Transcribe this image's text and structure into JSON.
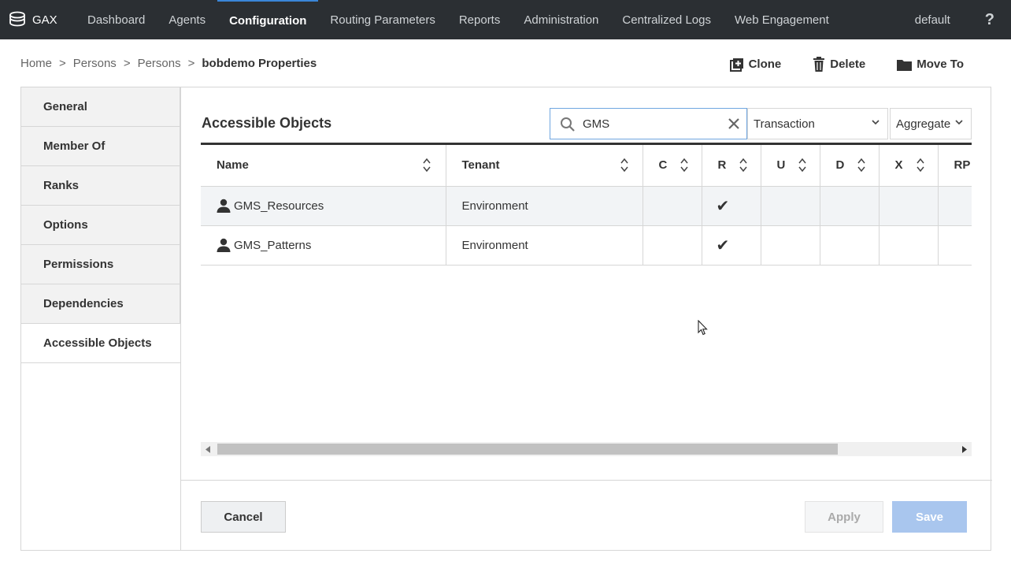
{
  "topnav": {
    "logo": "GAX",
    "items": [
      {
        "label": "Dashboard",
        "active": false
      },
      {
        "label": "Agents",
        "active": false
      },
      {
        "label": "Configuration",
        "active": true
      },
      {
        "label": "Routing Parameters",
        "active": false
      },
      {
        "label": "Reports",
        "active": false
      },
      {
        "label": "Administration",
        "active": false
      },
      {
        "label": "Centralized Logs",
        "active": false
      },
      {
        "label": "Web Engagement",
        "active": false
      }
    ],
    "user": "default",
    "help": "?"
  },
  "breadcrumb": {
    "items": [
      "Home",
      "Persons",
      "Persons"
    ],
    "separator": ">",
    "current": "bobdemo Properties"
  },
  "toolbar": {
    "clone_label": "Clone",
    "delete_label": "Delete",
    "move_label": "Move To"
  },
  "sidebar": {
    "items": [
      {
        "label": "General",
        "active": false
      },
      {
        "label": "Member Of",
        "active": false
      },
      {
        "label": "Ranks",
        "active": false
      },
      {
        "label": "Options",
        "active": false
      },
      {
        "label": "Permissions",
        "active": false
      },
      {
        "label": "Dependencies",
        "active": false
      },
      {
        "label": "Accessible Objects",
        "active": true
      }
    ]
  },
  "main": {
    "title": "Accessible Objects",
    "search": {
      "value": "GMS",
      "placeholder": ""
    },
    "type_select": "Transaction",
    "aggregate_select": "Aggregate",
    "table": {
      "columns": [
        "Name",
        "Tenant",
        "C",
        "R",
        "U",
        "D",
        "X",
        "RP"
      ],
      "rows": [
        {
          "name": "GMS_Resources",
          "tenant": "Environment",
          "c": "",
          "r": "✔",
          "u": "",
          "d": "",
          "x": "",
          "rp": ""
        },
        {
          "name": "GMS_Patterns",
          "tenant": "Environment",
          "c": "",
          "r": "✔",
          "u": "",
          "d": "",
          "x": "",
          "rp": ""
        }
      ]
    }
  },
  "footer": {
    "cancel_label": "Cancel",
    "apply_label": "Apply",
    "save_label": "Save"
  },
  "colors": {
    "nav_bg": "#2b2f33",
    "accent": "#3a86d8",
    "save_disabled": "#a9c6ee",
    "row_alt": "#f2f4f6"
  }
}
